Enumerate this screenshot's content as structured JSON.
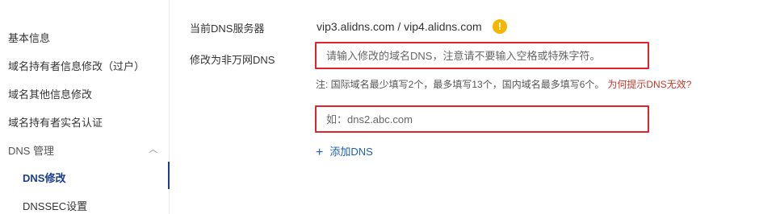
{
  "sidebar": {
    "items": [
      {
        "label": "基本信息"
      },
      {
        "label": "域名持有者信息修改（过户）"
      },
      {
        "label": "域名其他信息修改"
      },
      {
        "label": "域名持有者实名认证"
      },
      {
        "label": "DNS 管理"
      },
      {
        "label": "DNS修改"
      },
      {
        "label": "DNSSEC设置"
      }
    ]
  },
  "form": {
    "current_dns_label": "当前DNS服务器",
    "current_dns_value": "vip3.alidns.com / vip4.alidns.com",
    "warning_icon": "!",
    "change_label": "修改为非万网DNS",
    "dns1_placeholder": "请输入修改的域名DNS，注意请不要输入空格或特殊字符。",
    "dns2_placeholder": "如：dns2.abc.com",
    "note_text": "注:  国际域名最少填写2个，最多填写13个，国内域名最多填写6个。",
    "note_link": "为何提示DNS无效?",
    "add_plus": "+",
    "add_label": "添加DNS"
  },
  "colors": {
    "accent": "#1a3d8f",
    "link": "#1e5fb4",
    "highlight_border": "#e0242e",
    "warning": "#f5b500",
    "note_link": "#c0392b"
  }
}
